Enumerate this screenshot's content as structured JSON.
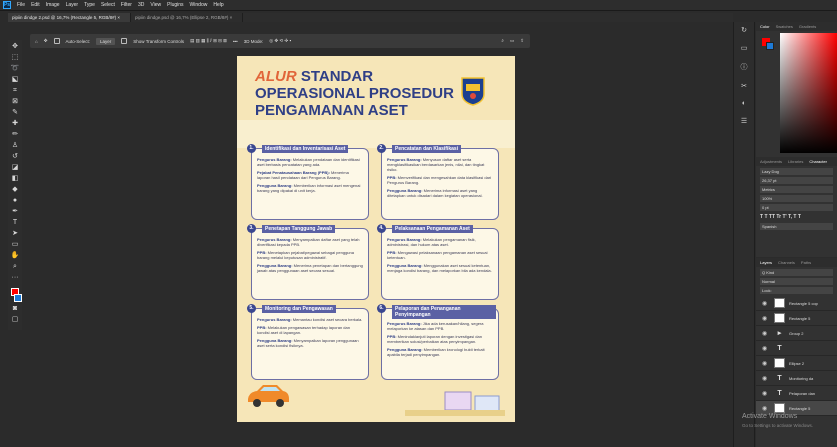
{
  "menubar": {
    "app_logo": "Ps",
    "items": [
      "File",
      "Edit",
      "Image",
      "Layer",
      "Type",
      "Select",
      "Filter",
      "3D",
      "View",
      "Plugins",
      "Window",
      "Help"
    ]
  },
  "tabs": [
    {
      "label": "pipiin dindge 2.psd @ 16,7% (Rectangle 5, RGB/8#) ×",
      "active": true
    },
    {
      "label": "pipiin dindge.psd @ 16,7% (Ellipse 2, RGB/8#) ×",
      "active": false
    }
  ],
  "options": {
    "auto_select": "Auto-Select:",
    "layer_value": "Layer",
    "transform": "Show Transform Controls",
    "mode_3d": "3D Mode:"
  },
  "poster": {
    "title_word": "ALUR",
    "title_rest1": " STANDAR",
    "title_line2": "OPERASIONAL PROSEDUR",
    "title_line3": "PENGAMANAN ASET",
    "cards": [
      {
        "num": "1.",
        "head": "Identifikasi dan Inventarisasi Aset",
        "p1b": "Pengurus Barang:",
        "p1": " Melakukan pendataan dan identifikasi aset berbasis pencatatan yang ada.",
        "p2b": "Pejabat Penatausahaan Barang (PPB):",
        "p2": " Menerima laporan hasil pendataan dari Pengurus Barang.",
        "p3b": "Pengguna Barang:",
        "p3": " Memberikan informasi aset mengenai barang yang dipakai di unit kerja."
      },
      {
        "num": "2.",
        "head": "Pencatatan dan Klasifikasi",
        "p1b": "Pengurus Barang:",
        "p1": " Menyusun daftar aset serta mengklasifikasikan berdasarkan jenis, nilai, dan tingkat risiko.",
        "p2b": "PPB:",
        "p2": " Memverifikasi dan mengesahkan data klasifikasi dari Pengurus Barang.",
        "p3b": "Pengguna Barang:",
        "p3": " Menerima informasi aset yang ditetapkan untuk disadari dalam kegiatan operasional."
      },
      {
        "num": "3.",
        "head": "Penetapan Tanggung Jawab",
        "p1b": "Pengurus Barang:",
        "p1": " Menyampaikan daftar aset yang telah diverifikasi kepada PPB.",
        "p2b": "PPB:",
        "p2": " Menetapkan pejabat/pegawai sebagai pengguna barang melalui keputusan administratif.",
        "p3b": "Pengguna Barang:",
        "p3": " Menerima penetapan dan bertanggung jawab atas penggunaan aset secara sesuai."
      },
      {
        "num": "4.",
        "head": "Pelaksanaan Pengamanan Aset",
        "p1b": "Pengurus Barang:",
        "p1": " Melakukan pengamanan fisik, administrasi, dan hukum atas aset.",
        "p2b": "PPB:",
        "p2": " Mengawasi pelaksanaan pengamanan aset sesuai ketentuan.",
        "p3b": "Pengguna Barang:",
        "p3": " Menggunakan aset sesuai ketentuan, menjaga kondisi barang, dan melaporkan bila ada kendala."
      },
      {
        "num": "5.",
        "head": "Monitoring dan Pengawasan",
        "p1b": "Pengurus Barang:",
        "p1": " Memantau kondisi aset secara berkala.",
        "p2b": "PPB:",
        "p2": " Melakukan pengawasan terhadap laporan dan kondisi aset di lapangan.",
        "p3b": "Pengguna Barang:",
        "p3": " Menyampaikan laporan penggunaan aset serta kondisi fisiknya."
      },
      {
        "num": "6.",
        "head": "Pelaporan dan Penanganan Penyimpangan",
        "p1b": "Pengurus Barang:",
        "p1": " Jika ada kerusakan/hilang, segera melaporkan ke atasan dan PPB.",
        "p2b": "PPB:",
        "p2": " Menindaklanjuti laporan dengan investigasi dan memberikan solusi/perbaikan atas penyimpangan.",
        "p3b": "Pengguna Barang:",
        "p3": " Memberikan kronologi bukti terkait apabila terjadi penyimpangan."
      }
    ]
  },
  "color_panel": {
    "tabs": [
      "Color",
      "Swatches",
      "Gradients"
    ]
  },
  "char_panel": {
    "tabs": [
      "Adjustments",
      "Libraries",
      "Character"
    ],
    "font": "Lazy Dog",
    "size": "26,37 pt",
    "kerning": "Metrics",
    "scale": "100%",
    "baseline": "0 pt",
    "language": "Spanish"
  },
  "layers_panel": {
    "tabs": [
      "Layers",
      "Channels",
      "Paths"
    ],
    "kind": "Q Kind",
    "blend": "Normal",
    "opacity": "Opaci",
    "lock": "Lock:",
    "layers": [
      {
        "type": "shape",
        "name": "Rectangle 5 cop"
      },
      {
        "type": "shape",
        "name": "Rectangle 5"
      },
      {
        "type": "group",
        "name": "Group 2"
      },
      {
        "type": "text",
        "name": "T"
      },
      {
        "type": "shape",
        "name": "Ellipse 2"
      },
      {
        "type": "text",
        "name": "Monitoring da"
      },
      {
        "type": "text",
        "name": "Pelaporan dan"
      },
      {
        "type": "shape",
        "name": "Rectangle 5"
      }
    ]
  },
  "watermark": {
    "line1": "Activate Windows",
    "line2": "Go to Settings to activate Windows."
  }
}
